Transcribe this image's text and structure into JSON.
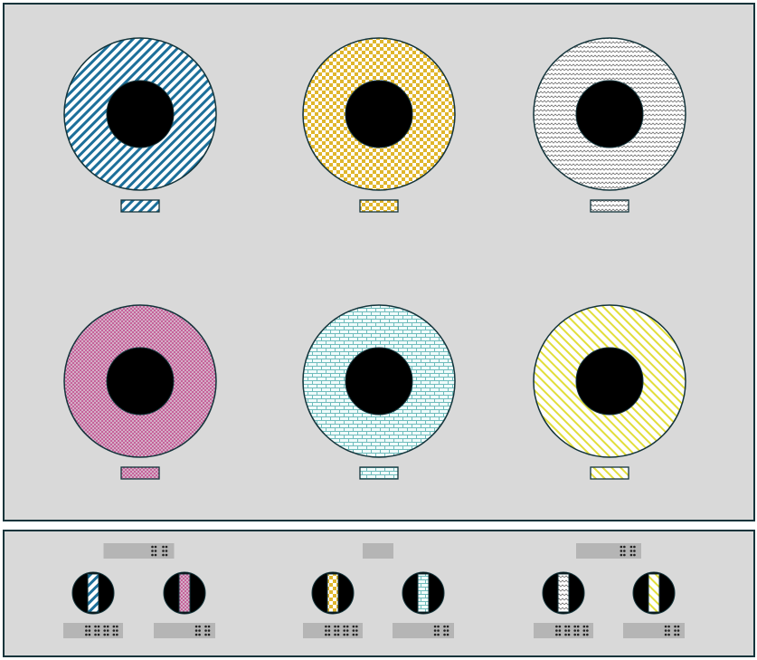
{
  "colors": {
    "panel_bg": "#d9d9d9",
    "outline": "#13343b",
    "hole": "#000000",
    "braille_bar": "#b5b5b5",
    "braille_dot": "#222222"
  },
  "items": [
    {
      "id": "a",
      "name": "blue-diagonal",
      "pattern": "diagonal-lines",
      "fg": "#1c6f9a",
      "bg": "#ffffff"
    },
    {
      "id": "b",
      "name": "gold-checker",
      "pattern": "checker",
      "fg": "#e0b62c",
      "bg": "#ffffff"
    },
    {
      "id": "c",
      "name": "grey-zigzag",
      "pattern": "zigzag",
      "fg": "#777777",
      "bg": "#ffffff"
    },
    {
      "id": "d",
      "name": "pink-dotted",
      "pattern": "dots",
      "fg": "#c45c96",
      "bg": "#d4b0c8"
    },
    {
      "id": "e",
      "name": "teal-brick",
      "pattern": "brick",
      "fg": "#6fbcbc",
      "bg": "#f0fbfb"
    },
    {
      "id": "f",
      "name": "yellow-diagonal",
      "pattern": "diagonal-lines-reverse",
      "fg": "#e2de3a",
      "bg": "#ffffff"
    }
  ],
  "bottom_groups": [
    {
      "left": "a",
      "right": "d"
    },
    {
      "left": "b",
      "right": "e"
    },
    {
      "left": "c",
      "right": "f"
    }
  ]
}
